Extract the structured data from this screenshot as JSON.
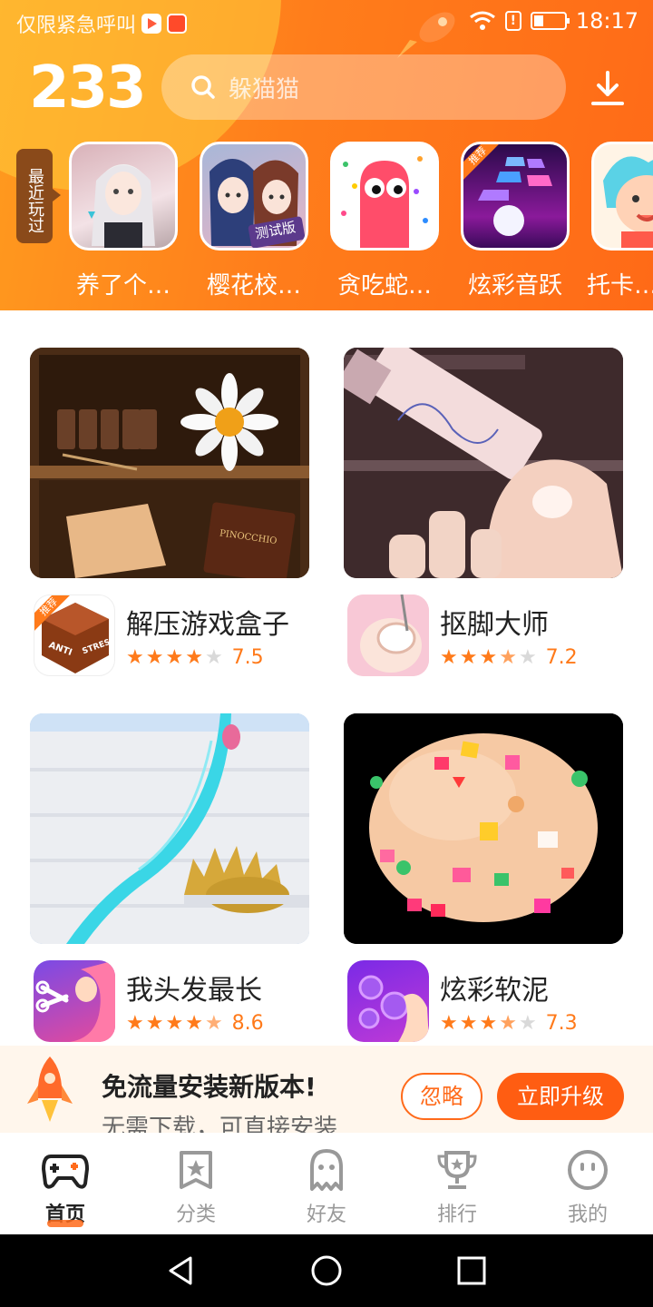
{
  "status_bar": {
    "notification_text": "仅限紧急呼叫",
    "time": "18:17"
  },
  "header": {
    "logo": "233",
    "search_placeholder": "躲猫猫"
  },
  "recent": {
    "tag": "最近玩过",
    "items": [
      {
        "name": "养了个…",
        "icon": "anime-girl-icon"
      },
      {
        "name": "樱花校…",
        "icon": "sakura-school-icon",
        "badge": "测试版"
      },
      {
        "name": "贪吃蛇…",
        "icon": "snake-icon"
      },
      {
        "name": "炫彩音跃",
        "icon": "music-tiles-icon",
        "badge": "推荐"
      },
      {
        "name": "托卡…",
        "icon": "toca-icon"
      }
    ]
  },
  "games": [
    {
      "title": "解压游戏盒子",
      "score": "7.5",
      "stars": 3.5,
      "icon_badge": "推荐",
      "icon_text_1": "ANTI",
      "icon_text_2": "STRESS",
      "book_text": "PINOCCHIO"
    },
    {
      "title": "抠脚大师",
      "score": "7.2",
      "stars": 3.5
    },
    {
      "title": "我头发最长",
      "score": "8.6",
      "stars": 4.5
    },
    {
      "title": "炫彩软泥",
      "score": "7.3",
      "stars": 3.5
    }
  ],
  "upgrade": {
    "title": "免流量安装新版本!",
    "subtitle": "无需下载，可直接安装",
    "ignore_label": "忽略",
    "upgrade_label": "立即升级"
  },
  "tabs": [
    {
      "label": "首页",
      "icon": "gamepad-icon",
      "active": true
    },
    {
      "label": "分类",
      "icon": "category-star-icon",
      "active": false
    },
    {
      "label": "好友",
      "icon": "ghost-friend-icon",
      "active": false
    },
    {
      "label": "排行",
      "icon": "trophy-icon",
      "active": false
    },
    {
      "label": "我的",
      "icon": "smiley-profile-icon",
      "active": false
    }
  ],
  "colors": {
    "brand_orange": "#ff6a17",
    "header_yellow": "#ffb52a",
    "star_active": "#ff7a1a",
    "star_inactive": "#d9d9d9",
    "banner_bg": "#fff6ec"
  }
}
